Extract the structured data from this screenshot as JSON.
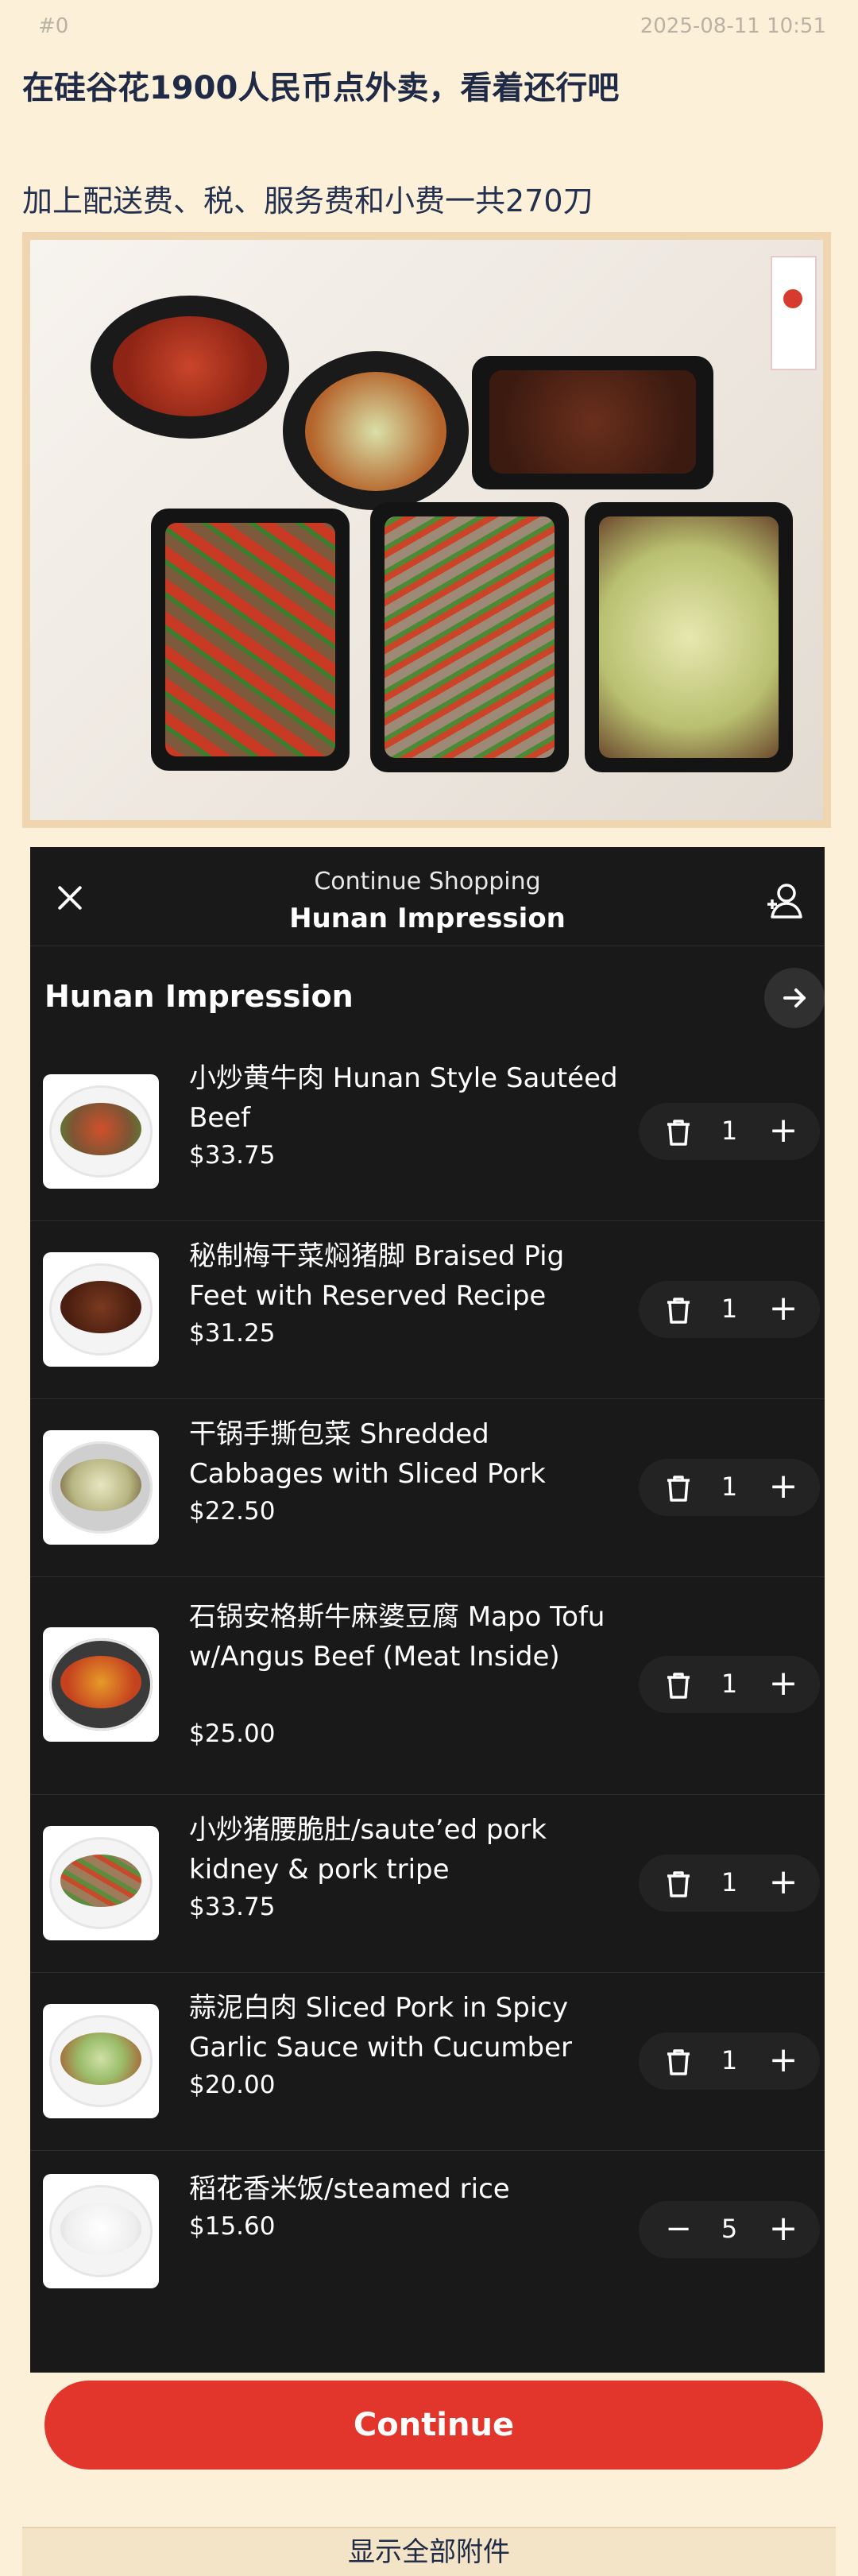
{
  "meta": {
    "index": "#0",
    "timestamp": "2025-08-11 10:51"
  },
  "post": {
    "title": "在硅谷花1900人民币点外卖，看着还行吧",
    "body": "加上配送费、税、服务费和小费一共270刀"
  },
  "cart": {
    "header_sub": "Continue Shopping",
    "header_title": "Hunan Impression",
    "store_name": "Hunan Impression",
    "items": [
      {
        "name": "小炒黄牛肉 Hunan Style Sautéed Beef",
        "price": "$33.75",
        "qty": "1",
        "action": "trash"
      },
      {
        "name": "秘制梅干菜焖猪脚 Braised Pig Feet with Reserved Recipe",
        "price": "$31.25",
        "qty": "1",
        "action": "trash"
      },
      {
        "name": "干锅手撕包菜 Shredded Cabbages with Sliced Pork",
        "price": "$22.50",
        "qty": "1",
        "action": "trash"
      },
      {
        "name": "石锅安格斯牛麻婆豆腐 Mapo Tofu w/Angus Beef (Meat Inside)",
        "price": "$25.00",
        "qty": "1",
        "action": "trash"
      },
      {
        "name": "小炒猪腰脆肚/saute’ed pork kidney & pork tripe",
        "price": "$33.75",
        "qty": "1",
        "action": "trash"
      },
      {
        "name": "蒜泥白肉 Sliced Pork in Spicy Garlic Sauce with Cucumber",
        "price": "$20.00",
        "qty": "1",
        "action": "trash"
      },
      {
        "name": "稻花香米饭/steamed rice",
        "price": "$15.60",
        "qty": "5",
        "action": "minus"
      }
    ],
    "continue_label": "Continue",
    "minus_symbol": "−",
    "plus_symbol": "+"
  },
  "footer": {
    "label": "显示全部附件"
  },
  "colors": {
    "accent": "#e2362c",
    "app_bg": "#191919",
    "page_bg": "#fdf0d8"
  }
}
